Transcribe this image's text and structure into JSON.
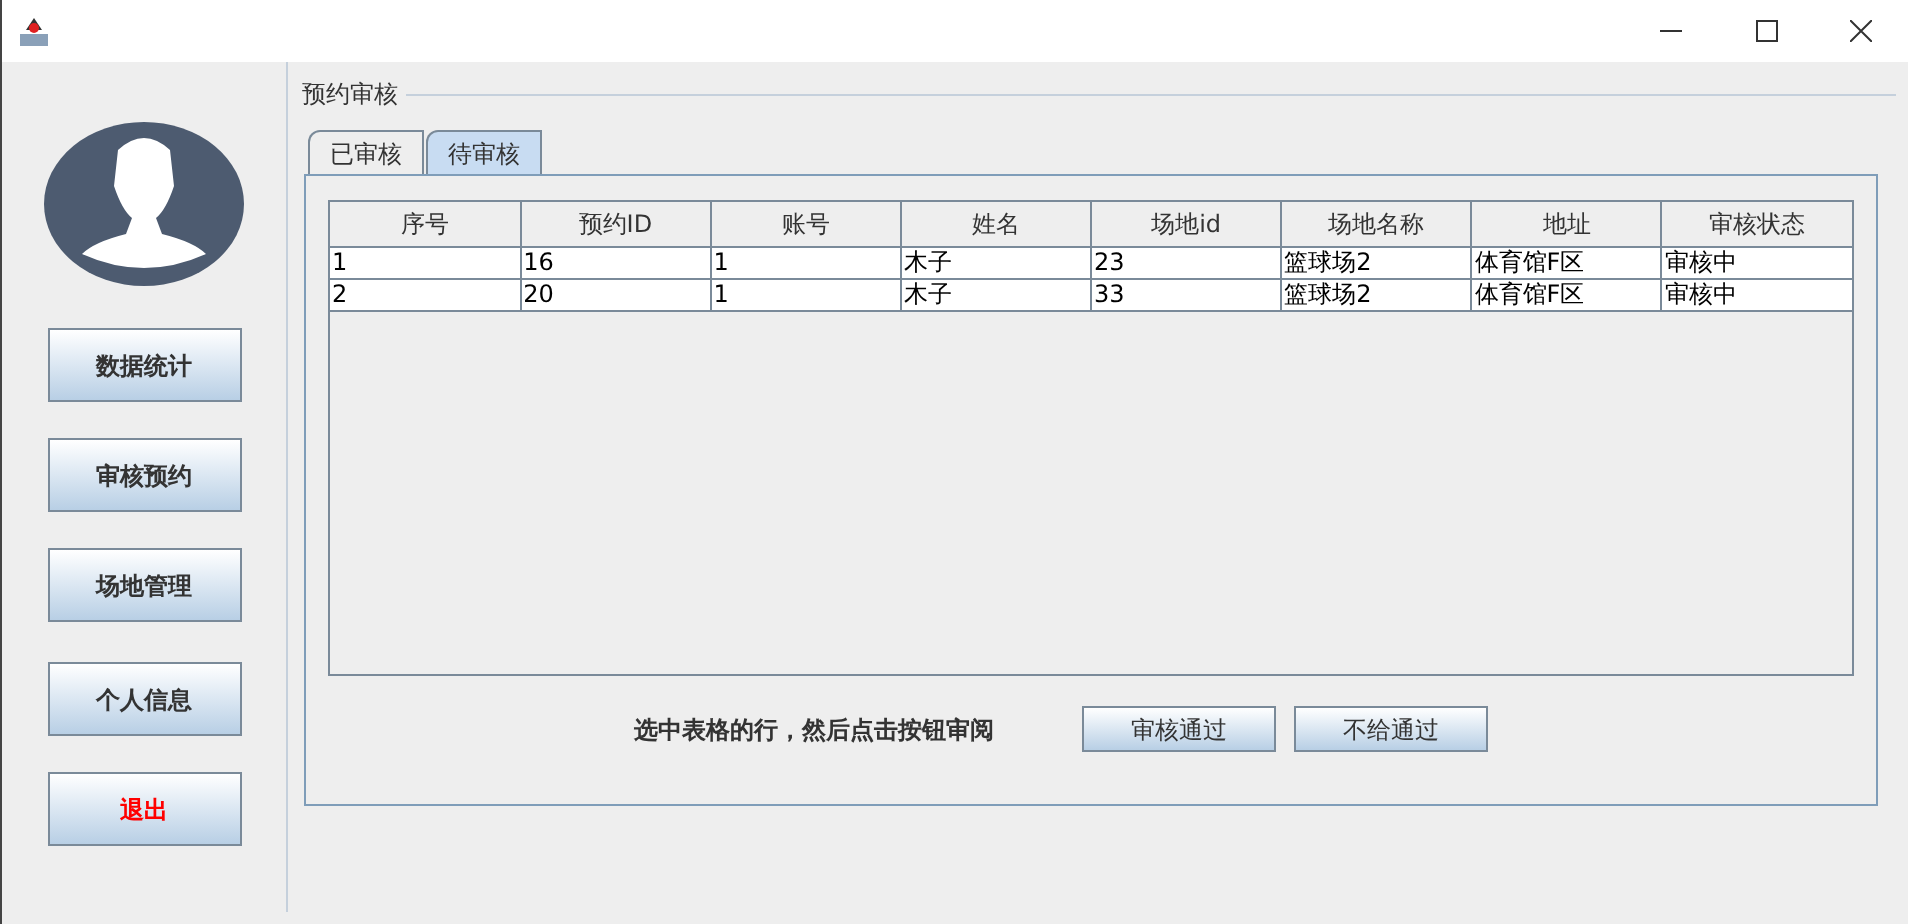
{
  "sidebar": {
    "buttons": [
      {
        "label": "数据统计",
        "kind": "normal"
      },
      {
        "label": "审核预约",
        "kind": "normal"
      },
      {
        "label": "场地管理",
        "kind": "normal"
      },
      {
        "label": "个人信息",
        "kind": "normal"
      },
      {
        "label": "退出",
        "kind": "exit"
      }
    ]
  },
  "panel": {
    "title": "预约审核",
    "tabs": [
      {
        "label": "已审核",
        "selected": false
      },
      {
        "label": "待审核",
        "selected": true
      }
    ],
    "table": {
      "columns": [
        "序号",
        "预约ID",
        "账号",
        "姓名",
        "场地id",
        "场地名称",
        "地址",
        "审核状态"
      ],
      "rows": [
        [
          "1",
          "16",
          "1",
          "木子",
          "23",
          "篮球场2",
          "体育馆F区",
          "审核中"
        ],
        [
          "2",
          "20",
          "1",
          "木子",
          "33",
          "篮球场2",
          "体育馆F区",
          "审核中"
        ]
      ]
    },
    "hint": "选中表格的行，然后点击按钮审阅",
    "buttons": [
      "审核通过",
      "不给通过"
    ]
  }
}
